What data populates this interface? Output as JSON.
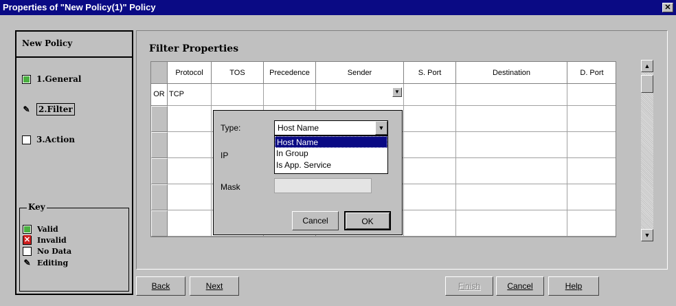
{
  "window": {
    "title": "Properties of \"New Policy(1)\" Policy",
    "close_glyph": "✕"
  },
  "left_panel": {
    "policy_name": "New Policy",
    "steps": [
      {
        "label": "1.General",
        "status": "valid"
      },
      {
        "label": "2.Filter",
        "status": "editing"
      },
      {
        "label": "3.Action",
        "status": "no-data"
      }
    ]
  },
  "key": {
    "title": "Key",
    "items": [
      {
        "label": "Valid",
        "icon": "valid-check-icon"
      },
      {
        "label": "Invalid",
        "icon": "invalid-x-icon"
      },
      {
        "label": "No Data",
        "icon": "empty-box-icon"
      },
      {
        "label": "Editing",
        "icon": "pencil-icon"
      }
    ]
  },
  "filter": {
    "title": "Filter Properties",
    "columns": [
      "Protocol",
      "TOS",
      "Precedence",
      "Sender",
      "S. Port",
      "Destination",
      "D. Port"
    ],
    "row1": {
      "prefix": "OR",
      "protocol": "TCP"
    }
  },
  "popup": {
    "type_label": "Type:",
    "type_value": "Host Name",
    "options": [
      "Host Name",
      "In Group",
      "Is App. Service"
    ],
    "ip_label": "IP",
    "mask_label": "Mask",
    "cancel_label": "Cancel",
    "ok_label": "OK"
  },
  "buttons": {
    "back": "Back",
    "next": "Next",
    "finish": "Finish",
    "cancel": "Cancel",
    "help": "Help"
  },
  "colors": {
    "titlebar": "#0a0a84",
    "valid": "#4ab040",
    "invalid": "#d02020",
    "face": "#c0c0c0"
  }
}
